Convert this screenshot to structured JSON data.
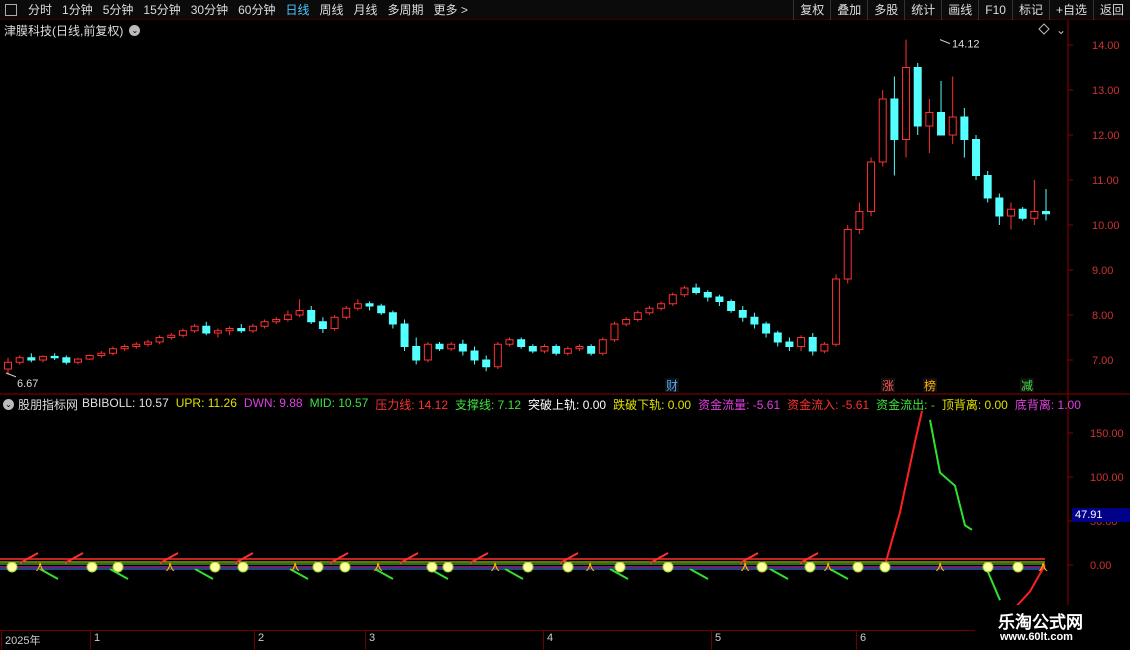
{
  "toolbar": {
    "tabs": [
      "分时",
      "1分钟",
      "5分钟",
      "15分钟",
      "30分钟",
      "60分钟",
      "日线",
      "周线",
      "月线",
      "多周期",
      "更多 >"
    ],
    "active_tab": "日线",
    "right_buttons": [
      "复权",
      "叠加",
      "多股",
      "统计",
      "画线",
      "F10",
      "标记",
      "+自选",
      "返回"
    ]
  },
  "main": {
    "title": "津膜科技(日线,前复权)",
    "price_axis": [
      "14.00",
      "13.00",
      "12.00",
      "11.00",
      "10.00",
      "9.00",
      "8.00",
      "7.00"
    ],
    "high_label": "14.12",
    "low_label": "6.67",
    "markers": [
      "财",
      "涨",
      "榜",
      "减"
    ]
  },
  "indicator": {
    "name": "股朋指标网",
    "items": [
      {
        "label": "BBIBOLL: 10.57",
        "color": "#e0e0e0"
      },
      {
        "label": "UPR: 11.26",
        "color": "#e0e000"
      },
      {
        "label": "DWN: 9.88",
        "color": "#e040e0"
      },
      {
        "label": "MID: 10.57",
        "color": "#40e040"
      },
      {
        "label": "压力线: 14.12",
        "color": "#ff3030"
      },
      {
        "label": "支撑线: 7.12",
        "color": "#40e040"
      },
      {
        "label": "突破上轨: 0.00",
        "color": "#ffffff"
      },
      {
        "label": "跌破下轨: 0.00",
        "color": "#e0e000"
      },
      {
        "label": "资金流量: -5.61",
        "color": "#e040e0"
      },
      {
        "label": "资金流入: -5.61",
        "color": "#ff3030"
      },
      {
        "label": "资金流出: -",
        "color": "#40e040"
      },
      {
        "label": "顶背离: 0.00",
        "color": "#e0e000"
      },
      {
        "label": "底背离: 1.00",
        "color": "#e040e0"
      }
    ],
    "axis": [
      "150.00",
      "100.00",
      "50.00",
      "0.00"
    ],
    "current_value": "47.91"
  },
  "date_axis": {
    "labels": [
      "2025年",
      "1",
      "2",
      "3",
      "4",
      "5",
      "6"
    ]
  },
  "watermark": {
    "title": "乐淘公式网",
    "url": "www.60lt.com"
  },
  "chart_data": {
    "type": "candlestick",
    "title": "津膜科技(日线,前复权)",
    "y_axis_ticks": [
      7,
      8,
      9,
      10,
      11,
      12,
      13,
      14
    ],
    "ylim": [
      6.2,
      14.4
    ],
    "highest": 14.12,
    "lowest": 6.67,
    "candles_ohlc": [
      [
        6.8,
        7.05,
        6.67,
        6.95
      ],
      [
        6.95,
        7.1,
        6.9,
        7.05
      ],
      [
        7.05,
        7.15,
        6.95,
        7.0
      ],
      [
        7.0,
        7.1,
        6.95,
        7.08
      ],
      [
        7.08,
        7.15,
        7.0,
        7.05
      ],
      [
        7.05,
        7.1,
        6.9,
        6.95
      ],
      [
        6.95,
        7.05,
        6.9,
        7.02
      ],
      [
        7.02,
        7.12,
        7.0,
        7.1
      ],
      [
        7.1,
        7.2,
        7.05,
        7.15
      ],
      [
        7.15,
        7.3,
        7.1,
        7.25
      ],
      [
        7.25,
        7.35,
        7.2,
        7.3
      ],
      [
        7.3,
        7.4,
        7.25,
        7.35
      ],
      [
        7.35,
        7.45,
        7.3,
        7.4
      ],
      [
        7.4,
        7.55,
        7.35,
        7.5
      ],
      [
        7.5,
        7.6,
        7.45,
        7.55
      ],
      [
        7.55,
        7.7,
        7.5,
        7.65
      ],
      [
        7.65,
        7.8,
        7.6,
        7.75
      ],
      [
        7.75,
        7.85,
        7.55,
        7.6
      ],
      [
        7.6,
        7.7,
        7.5,
        7.65
      ],
      [
        7.65,
        7.75,
        7.55,
        7.7
      ],
      [
        7.7,
        7.8,
        7.6,
        7.65
      ],
      [
        7.65,
        7.8,
        7.6,
        7.75
      ],
      [
        7.75,
        7.9,
        7.7,
        7.85
      ],
      [
        7.85,
        7.95,
        7.8,
        7.9
      ],
      [
        7.9,
        8.1,
        7.85,
        8.0
      ],
      [
        8.0,
        8.35,
        7.95,
        8.1
      ],
      [
        8.1,
        8.2,
        7.8,
        7.85
      ],
      [
        7.85,
        7.95,
        7.6,
        7.7
      ],
      [
        7.7,
        8.0,
        7.65,
        7.95
      ],
      [
        7.95,
        8.2,
        7.9,
        8.15
      ],
      [
        8.15,
        8.35,
        8.1,
        8.25
      ],
      [
        8.25,
        8.3,
        8.1,
        8.2
      ],
      [
        8.2,
        8.25,
        8.0,
        8.05
      ],
      [
        8.05,
        8.1,
        7.7,
        7.8
      ],
      [
        7.8,
        7.9,
        7.2,
        7.3
      ],
      [
        7.3,
        7.5,
        6.9,
        7.0
      ],
      [
        7.0,
        7.4,
        6.95,
        7.35
      ],
      [
        7.35,
        7.4,
        7.2,
        7.25
      ],
      [
        7.25,
        7.4,
        7.2,
        7.35
      ],
      [
        7.35,
        7.45,
        7.1,
        7.2
      ],
      [
        7.2,
        7.3,
        6.9,
        7.0
      ],
      [
        7.0,
        7.1,
        6.75,
        6.85
      ],
      [
        6.85,
        7.4,
        6.8,
        7.35
      ],
      [
        7.35,
        7.5,
        7.3,
        7.45
      ],
      [
        7.45,
        7.5,
        7.25,
        7.3
      ],
      [
        7.3,
        7.35,
        7.15,
        7.2
      ],
      [
        7.2,
        7.35,
        7.15,
        7.3
      ],
      [
        7.3,
        7.35,
        7.1,
        7.15
      ],
      [
        7.15,
        7.3,
        7.1,
        7.25
      ],
      [
        7.25,
        7.35,
        7.2,
        7.3
      ],
      [
        7.3,
        7.35,
        7.1,
        7.15
      ],
      [
        7.15,
        7.5,
        7.1,
        7.45
      ],
      [
        7.45,
        7.85,
        7.4,
        7.8
      ],
      [
        7.8,
        7.95,
        7.75,
        7.9
      ],
      [
        7.9,
        8.1,
        7.85,
        8.05
      ],
      [
        8.05,
        8.2,
        8.0,
        8.15
      ],
      [
        8.15,
        8.3,
        8.1,
        8.25
      ],
      [
        8.25,
        8.5,
        8.2,
        8.45
      ],
      [
        8.45,
        8.65,
        8.4,
        8.6
      ],
      [
        8.6,
        8.7,
        8.45,
        8.5
      ],
      [
        8.5,
        8.55,
        8.3,
        8.4
      ],
      [
        8.4,
        8.45,
        8.2,
        8.3
      ],
      [
        8.3,
        8.35,
        8.05,
        8.1
      ],
      [
        8.1,
        8.2,
        7.85,
        7.95
      ],
      [
        7.95,
        8.05,
        7.7,
        7.8
      ],
      [
        7.8,
        7.85,
        7.5,
        7.6
      ],
      [
        7.6,
        7.65,
        7.3,
        7.4
      ],
      [
        7.4,
        7.5,
        7.2,
        7.3
      ],
      [
        7.3,
        7.55,
        7.2,
        7.5
      ],
      [
        7.5,
        7.6,
        7.1,
        7.2
      ],
      [
        7.2,
        7.4,
        7.15,
        7.35
      ],
      [
        7.35,
        8.9,
        7.3,
        8.8
      ],
      [
        8.8,
        10.0,
        8.7,
        9.9
      ],
      [
        9.9,
        10.5,
        9.8,
        10.3
      ],
      [
        10.3,
        11.5,
        10.2,
        11.4
      ],
      [
        11.4,
        13.0,
        11.3,
        12.8
      ],
      [
        12.8,
        13.3,
        11.1,
        11.9
      ],
      [
        11.9,
        14.12,
        11.5,
        13.5
      ],
      [
        13.5,
        13.6,
        12.0,
        12.2
      ],
      [
        12.2,
        12.8,
        11.6,
        12.5
      ],
      [
        12.5,
        13.2,
        12.2,
        12.0
      ],
      [
        12.0,
        13.3,
        11.8,
        12.4
      ],
      [
        12.4,
        12.6,
        11.5,
        11.9
      ],
      [
        11.9,
        12.0,
        11.0,
        11.1
      ],
      [
        11.1,
        11.2,
        10.5,
        10.6
      ],
      [
        10.6,
        10.7,
        10.0,
        10.2
      ],
      [
        10.2,
        10.5,
        9.9,
        10.35
      ],
      [
        10.35,
        10.4,
        10.1,
        10.15
      ],
      [
        10.15,
        11.0,
        10.0,
        10.3
      ],
      [
        10.3,
        10.8,
        10.1,
        10.25
      ]
    ]
  }
}
